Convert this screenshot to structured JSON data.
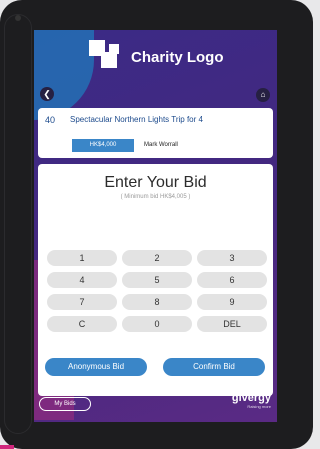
{
  "logo": {
    "text": "Charity Logo"
  },
  "nav": {
    "back_icon": "back-icon",
    "home_icon": "home-icon"
  },
  "item": {
    "lot_number": "40",
    "title": "Spectacular Northern Lights Trip for 4",
    "current_bid": "HK$4,000",
    "bidder": "Mark Worrall"
  },
  "bid": {
    "heading": "Enter Your Bid",
    "minimum_hint": "( Minimum bid HK$4,005 )"
  },
  "keypad": {
    "keys": [
      "1",
      "2",
      "3",
      "4",
      "5",
      "6",
      "7",
      "8",
      "9",
      "C",
      "0",
      "DEL"
    ]
  },
  "actions": {
    "anonymous_label": "Anonymous Bid",
    "confirm_label": "Confirm Bid"
  },
  "footer": {
    "my_bids_label": "My Bids",
    "brand_name": "givergy",
    "brand_tagline": "Raising more"
  },
  "colors": {
    "accent": "#3a86c8",
    "background": "#3b2a86",
    "key_bg": "#e3e3e3"
  }
}
